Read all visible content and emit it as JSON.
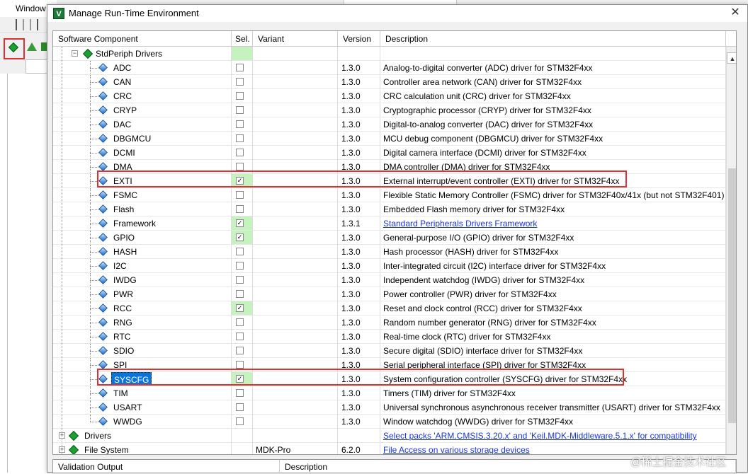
{
  "background": {
    "menu_label": "Window"
  },
  "window": {
    "title": "Manage Run-Time Environment",
    "close_glyph": "✕"
  },
  "columns": {
    "component": "Software Component",
    "sel": "Sel.",
    "variant": "Variant",
    "version": "Version",
    "description": "Description"
  },
  "group": {
    "name": "StdPeriph Drivers",
    "expander": "−"
  },
  "rows": [
    {
      "name": "ADC",
      "checked": false,
      "version": "1.3.0",
      "description": "Analog-to-digital converter (ADC) driver for STM32F4xx",
      "link": false
    },
    {
      "name": "CAN",
      "checked": false,
      "version": "1.3.0",
      "description": "Controller area network (CAN) driver for STM32F4xx",
      "link": false
    },
    {
      "name": "CRC",
      "checked": false,
      "version": "1.3.0",
      "description": "CRC calculation unit (CRC) driver for STM32F4xx",
      "link": false
    },
    {
      "name": "CRYP",
      "checked": false,
      "version": "1.3.0",
      "description": "Cryptographic processor (CRYP) driver for STM32F4xx",
      "link": false
    },
    {
      "name": "DAC",
      "checked": false,
      "version": "1.3.0",
      "description": "Digital-to-analog converter (DAC) driver for STM32F4xx",
      "link": false
    },
    {
      "name": "DBGMCU",
      "checked": false,
      "version": "1.3.0",
      "description": "MCU debug component (DBGMCU) driver for STM32F4xx",
      "link": false
    },
    {
      "name": "DCMI",
      "checked": false,
      "version": "1.3.0",
      "description": "Digital camera interface (DCMI) driver for STM32F4xx",
      "link": false
    },
    {
      "name": "DMA",
      "checked": false,
      "version": "1.3.0",
      "description": "DMA controller (DMA) driver for STM32F4xx",
      "link": false
    },
    {
      "name": "EXTI",
      "checked": true,
      "version": "1.3.0",
      "description": "External interrupt/event controller (EXTI) driver for STM32F4xx",
      "link": false,
      "highlight": true
    },
    {
      "name": "FSMC",
      "checked": false,
      "version": "1.3.0",
      "description": "Flexible Static Memory Controller (FSMC) driver for STM32F40x/41x (but not STM32F401)",
      "link": false
    },
    {
      "name": "Flash",
      "checked": false,
      "version": "1.3.0",
      "description": "Embedded Flash memory driver for STM32F4xx",
      "link": false
    },
    {
      "name": "Framework",
      "checked": true,
      "version": "1.3.1",
      "description": "Standard Peripherals Drivers Framework",
      "link": true
    },
    {
      "name": "GPIO",
      "checked": true,
      "version": "1.3.0",
      "description": "General-purpose I/O (GPIO) driver for STM32F4xx",
      "link": false
    },
    {
      "name": "HASH",
      "checked": false,
      "version": "1.3.0",
      "description": "Hash processor (HASH) driver for STM32F4xx",
      "link": false
    },
    {
      "name": "I2C",
      "checked": false,
      "version": "1.3.0",
      "description": "Inter-integrated circuit (I2C) interface driver for STM32F4xx",
      "link": false
    },
    {
      "name": "IWDG",
      "checked": false,
      "version": "1.3.0",
      "description": "Independent watchdog (IWDG) driver for STM32F4xx",
      "link": false
    },
    {
      "name": "PWR",
      "checked": false,
      "version": "1.3.0",
      "description": "Power controller (PWR) driver for STM32F4xx",
      "link": false
    },
    {
      "name": "RCC",
      "checked": true,
      "version": "1.3.0",
      "description": "Reset and clock control (RCC) driver for STM32F4xx",
      "link": false
    },
    {
      "name": "RNG",
      "checked": false,
      "version": "1.3.0",
      "description": "Random number generator (RNG) driver for STM32F4xx",
      "link": false
    },
    {
      "name": "RTC",
      "checked": false,
      "version": "1.3.0",
      "description": "Real-time clock (RTC) driver for STM32F4xx",
      "link": false
    },
    {
      "name": "SDIO",
      "checked": false,
      "version": "1.3.0",
      "description": "Secure digital (SDIO) interface driver for STM32F4xx",
      "link": false
    },
    {
      "name": "SPI",
      "checked": false,
      "version": "1.3.0",
      "description": "Serial peripheral interface (SPI) driver for STM32F4xx",
      "link": false
    },
    {
      "name": "SYSCFG",
      "checked": true,
      "version": "1.3.0",
      "description": "System configuration controller (SYSCFG) driver for STM32F4xx",
      "link": false,
      "highlight": true,
      "selected": true
    },
    {
      "name": "TIM",
      "checked": false,
      "version": "1.3.0",
      "description": "Timers (TIM) driver for STM32F4xx",
      "link": false
    },
    {
      "name": "USART",
      "checked": false,
      "version": "1.3.0",
      "description": "Universal synchronous asynchronous receiver transmitter (USART) driver for STM32F4xx",
      "link": false
    },
    {
      "name": "WWDG",
      "checked": false,
      "version": "1.3.0",
      "description": "Window watchdog (WWDG) driver for STM32F4xx",
      "link": false
    }
  ],
  "tail_rows": [
    {
      "name": "Drivers",
      "variant": "",
      "version": "",
      "description": "Select packs 'ARM.CMSIS.3.20.x' and 'Keil.MDK-Middleware.5.1.x' for compatibility",
      "link": true,
      "expander": "+"
    },
    {
      "name": "File System",
      "variant": "MDK-Pro",
      "version": "6.2.0",
      "description": "File Access on various storage devices",
      "link": true,
      "expander": "+"
    }
  ],
  "bottom": {
    "validation_output": "Validation Output",
    "description": "Description"
  },
  "watermark": "@稀土掘金技术社区",
  "colors": {
    "highlight_box": "#e0302f",
    "selected_bg": "#0a74d8",
    "sel_green": "#c6f2c0",
    "link": "#1a35d6"
  }
}
